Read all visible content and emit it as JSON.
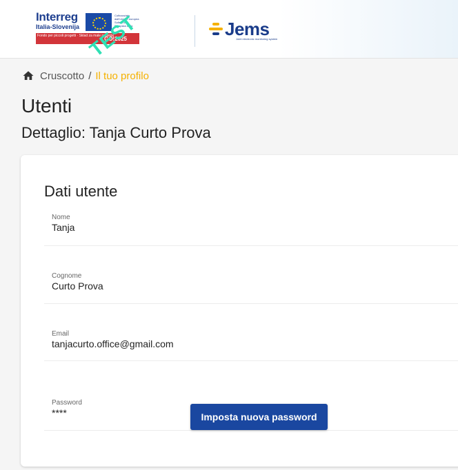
{
  "header": {
    "interreg": {
      "word": "Interreg",
      "subtitle": "Italia-Slovenija",
      "eu_text": "Cofinanziato dall'Unione europea Sofinancira Evropska unija",
      "red_text": "Fondo per piccoli progetti · Sklad za male projekte",
      "red_num": "GO!2025",
      "stamp": "TEST"
    },
    "jems": {
      "word": "Jems",
      "tagline": "Joint electronic monitoring system"
    }
  },
  "breadcrumb": {
    "home": "Cruscotto",
    "separator": "/",
    "current": "Il tuo profilo"
  },
  "page": {
    "title": "Utenti",
    "subtitle": "Dettaglio: Tanja Curto Prova"
  },
  "card": {
    "title": "Dati utente",
    "fields": [
      {
        "label": "Nome",
        "value": "Tanja"
      },
      {
        "label": "Cognome",
        "value": "Curto Prova"
      },
      {
        "label": "Email",
        "value": "tanjacurto.office@gmail.com"
      },
      {
        "label": "Password",
        "value": "****"
      }
    ],
    "set_password_button": "Imposta nuova password"
  },
  "colors": {
    "accent": "#f5b100",
    "primary": "#1a47a0",
    "brand_blue": "#1a3c8a",
    "test_stamp": "#2fe0b4"
  }
}
